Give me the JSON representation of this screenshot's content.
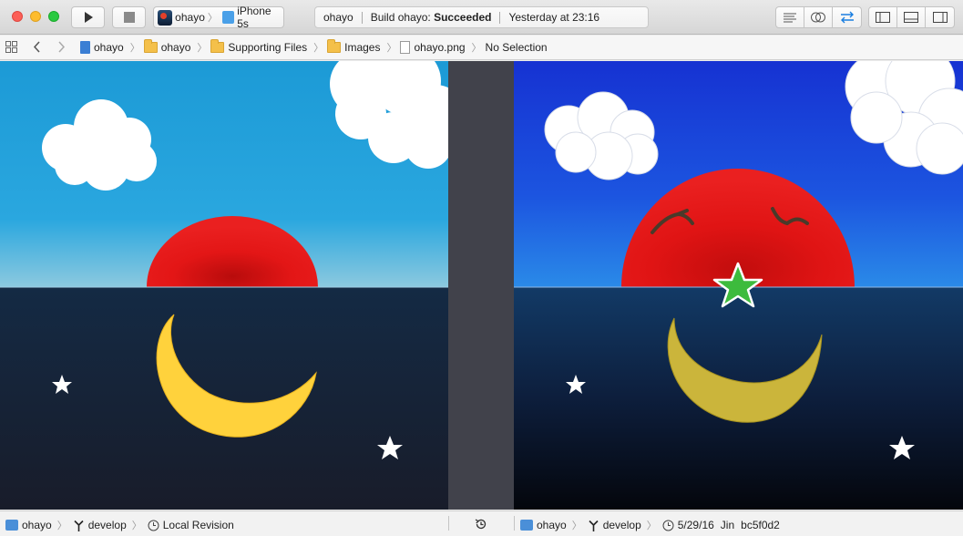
{
  "window": {
    "scheme": {
      "project": "ohayo",
      "device": "iPhone 5s"
    },
    "activity": {
      "project": "ohayo",
      "build_prefix": "Build ohayo:",
      "build_status": "Succeeded",
      "time": "Yesterday at 23:16"
    }
  },
  "jumpbar": {
    "crumbs": [
      "ohayo",
      "ohayo",
      "Supporting Files",
      "Images",
      "ohayo.png",
      "No Selection"
    ]
  },
  "bottom": {
    "left": {
      "repo": "ohayo",
      "branch": "develop",
      "revision": "Local Revision"
    },
    "right": {
      "repo": "ohayo",
      "branch": "develop",
      "date": "5/29/16",
      "author": "Jin",
      "commit": "bc5f0d2"
    }
  },
  "icons": {
    "run": "play-icon",
    "stop": "stop-icon",
    "editor": [
      "standard-editor-icon",
      "assistant-editor-icon",
      "version-editor-icon"
    ],
    "view": [
      "navigator-toggle-icon",
      "debug-toggle-icon",
      "utilities-toggle-icon"
    ]
  },
  "colors": {
    "left_sky": "#1c9ad6",
    "right_sky": "#1a43d8",
    "sun": "#e01414",
    "sea": "#142642",
    "moon_left": "#ffd23c",
    "moon_right": "#cbb53b",
    "star_green": "#3dbb3d"
  }
}
